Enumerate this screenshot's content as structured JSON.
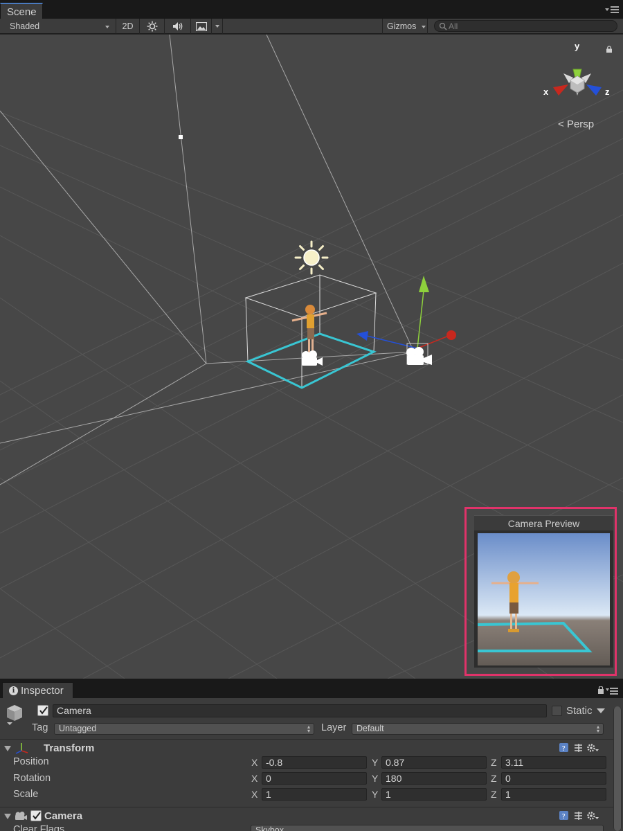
{
  "scene": {
    "tab_title": "Scene",
    "toolbar": {
      "draw_mode": "Shaded",
      "toggle_2d": "2D",
      "lighting_icon": "sun-icon",
      "audio_icon": "speaker-icon",
      "effects_icon": "image-icon",
      "gizmos_label": "Gizmos",
      "search_placeholder": "All"
    },
    "orientation_gizmo": {
      "x_label": "x",
      "y_label": "y",
      "z_label": "z",
      "projection_label": "Persp"
    },
    "camera_preview": {
      "title": "Camera Preview"
    },
    "colors": {
      "viewport_bg": "#474747",
      "bounds_highlight": "#39c6d3",
      "preview_border": "#e0336a",
      "axis_x": "#c8281e",
      "axis_y": "#8ed13c",
      "axis_z": "#2450d8"
    }
  },
  "inspector": {
    "tab_title": "Inspector",
    "object": {
      "enabled": true,
      "name": "Camera",
      "static_label": "Static",
      "static": false,
      "tag_label": "Tag",
      "tag_value": "Untagged",
      "layer_label": "Layer",
      "layer_value": "Default"
    },
    "transform": {
      "title": "Transform",
      "rows": [
        {
          "label": "Position",
          "x": "-0.8",
          "y": "0.87",
          "z": "3.11"
        },
        {
          "label": "Rotation",
          "x": "0",
          "y": "180",
          "z": "0"
        },
        {
          "label": "Scale",
          "x": "1",
          "y": "1",
          "z": "1"
        }
      ],
      "axis_x": "X",
      "axis_y": "Y",
      "axis_z": "Z"
    },
    "camera": {
      "title": "Camera",
      "enabled": true,
      "clear_flags_label": "Clear Flags",
      "clear_flags_value": "Skybox"
    }
  }
}
